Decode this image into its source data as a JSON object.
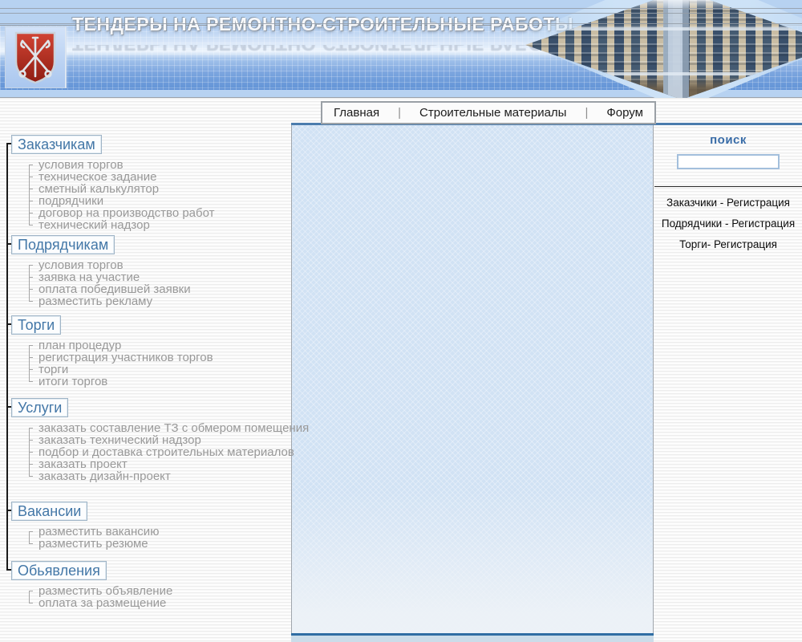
{
  "header": {
    "title": "ТЕНДЕРЫ НА РЕМОНТНО-СТРОИТЕЛЬНЫЕ РАБОТЫ"
  },
  "nav": {
    "separator": "|",
    "items": [
      {
        "label": "Главная"
      },
      {
        "label": "Строительные материалы"
      },
      {
        "label": "Форум"
      }
    ]
  },
  "sidebar": {
    "sections": [
      {
        "title": "Заказчикам",
        "items": [
          "условия торгов",
          "техническое задание",
          "сметный калькулятор",
          "подрядчики",
          "договор на производство работ",
          "технический надзор"
        ]
      },
      {
        "title": "Подрядчикам",
        "items": [
          "условия торгов",
          "заявка на участие",
          "оплата победившей заявки",
          "разместить рекламу"
        ]
      },
      {
        "title": "Торги",
        "items": [
          "план процедур",
          "регистрация участников  торгов",
          "торги",
          "итоги торгов"
        ]
      },
      {
        "title": "Услуги",
        "items": [
          "заказать составление ТЗ с обмером помещения",
          "заказать технический надзор",
          "подбор и доставка строительных материалов",
          "заказать проект",
          "заказать дизайн-проект"
        ]
      },
      {
        "title": "Вакансии",
        "items": [
          "разместить вакансию",
          "разместить резюме"
        ]
      },
      {
        "title": "Обьявления",
        "items": [
          "разместить объявление",
          "оплата за размещение"
        ]
      }
    ]
  },
  "search": {
    "label": "поиск",
    "value": ""
  },
  "registration": {
    "links": [
      {
        "label": "Заказчики - Регистрация"
      },
      {
        "label": "Подрядчики - Регистрация"
      },
      {
        "label": "Торги- Регистрация"
      }
    ]
  },
  "icons": {
    "crest": "spb-coat-of-arms-icon",
    "building": "office-building-photo"
  },
  "colors": {
    "accent_blue": "#4377a7",
    "band_blue": "#b7d2f1",
    "content_blue": "#d1e2f4",
    "shield_red": "#b52a1b",
    "footer_line": "#2f6da3"
  }
}
